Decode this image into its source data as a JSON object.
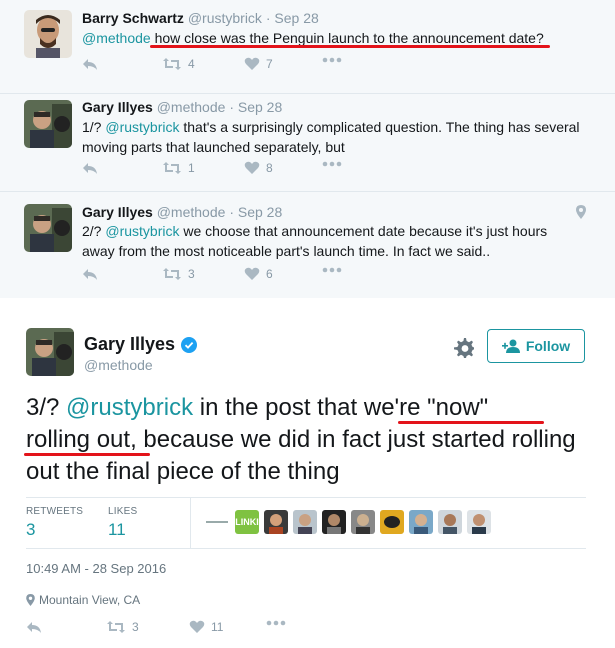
{
  "tweet1": {
    "name": "Barry Schwartz",
    "handle": "@rustybrick",
    "date": "Sep 28",
    "mention": "@methode",
    "text": " how close was the Penguin launch to the announcement date?",
    "retweets": "4",
    "likes": "7"
  },
  "tweet2": {
    "name": "Gary Illyes",
    "handle": "@methode",
    "date": "Sep 28",
    "prefix": "1/? ",
    "mention": "@rustybrick",
    "text": " that's a surprisingly complicated question. The thing has several moving parts that launched separately, but",
    "retweets": "1",
    "likes": "8"
  },
  "tweet3": {
    "name": "Gary Illyes",
    "handle": "@methode",
    "date": "Sep 28",
    "prefix": "2/? ",
    "mention": "@rustybrick",
    "text": " we choose that announcement date because it's just hours away from the most noticeable part's launch time. In fact we said..",
    "retweets": "3",
    "likes": "6"
  },
  "main": {
    "name": "Gary Illyes",
    "handle": "@methode",
    "follow_label": "Follow",
    "prefix": "3/? ",
    "mention": "@rustybrick",
    "text_a": " in the post that ",
    "text_b": "we're \"now\"",
    "text_c": " ",
    "text_d": "rolling out,",
    "text_e": " because we did in fact just started rolling out the final piece of the thing",
    "retweets_label": "RETWEETS",
    "retweets": "3",
    "likes_label": "LIKES",
    "likes": "11",
    "timestamp": "10:49 AM - 28 Sep 2016",
    "location": "Mountain View, CA",
    "action_retweets": "3",
    "action_likes": "11",
    "favoriter_logo_text": "LINKI"
  },
  "colors": {
    "accent": "#1b95a0",
    "highlight": "#e3131a",
    "muted": "#8899a6",
    "verified": "#1da1f2"
  }
}
